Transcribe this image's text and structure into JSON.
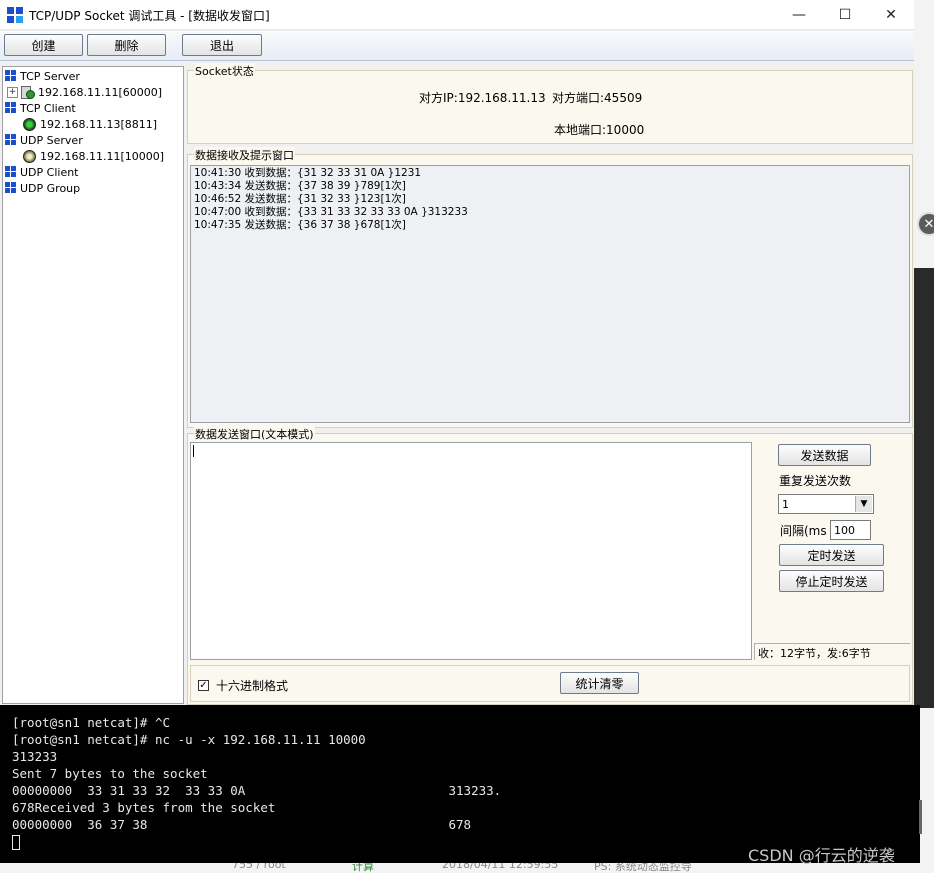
{
  "window": {
    "title": "TCP/UDP Socket 调试工具 - [数据收发窗口]",
    "minimize": "—",
    "maximize": "☐",
    "close": "✕"
  },
  "toolbar": {
    "create": "创建",
    "delete": "删除",
    "exit": "退出"
  },
  "tree": {
    "tcp_server": "TCP Server",
    "tcp_server_conn": "192.168.11.11[60000]",
    "tcp_client": "TCP Client",
    "tcp_client_conn": "192.168.11.13[8811]",
    "udp_server": "UDP Server",
    "udp_server_conn": "192.168.11.11[10000]",
    "udp_client": "UDP Client",
    "udp_group": "UDP Group"
  },
  "socket_status": {
    "label": "Socket状态",
    "remote_ip": "对方IP:192.168.11.13",
    "remote_port": "对方端口:45509",
    "local_port": "本地端口:10000"
  },
  "recv": {
    "label": "数据接收及提示窗口",
    "lines": [
      "10:41:30 收到数据：{31 32 33 31 0A }1231",
      "10:43:34 发送数据：{37 38 39 }789[1次]",
      "10:46:52 发送数据：{31 32 33 }123[1次]",
      "10:47:00 收到数据：{33 31 33 32 33 33 0A }313233",
      "10:47:35 发送数据：{36 37 38 }678[1次]"
    ]
  },
  "send": {
    "label": "数据发送窗口(文本模式)",
    "send_button": "发送数据",
    "repeat_label": "重复发送次数",
    "repeat_value": "1",
    "interval_label": "间隔(ms",
    "interval_value": "100",
    "timer_send": "定时发送",
    "stop_timer_send": "停止定时发送",
    "stats": "收：12字节，发:6字节"
  },
  "options": {
    "hex_format": "十六进制格式",
    "hex_checked": true,
    "clear_stats": "统计清零"
  },
  "terminal": {
    "lines": [
      "[root@sn1 netcat]# ^C",
      "[root@sn1 netcat]# nc -u -x 192.168.11.11 10000",
      "313233",
      "Sent 7 bytes to the socket",
      "00000000  33 31 33 32  33 33 0A                           313233.",
      "678Received 3 bytes from the socket",
      "00000000  36 37 38                                        678"
    ]
  },
  "background": {
    "col1": "755 / root",
    "col2": "计算",
    "col3": "2018/04/11 12:59:55",
    "col4": "PS: 系统动态监控导"
  },
  "watermark": "CSDN @行云的逆袭"
}
